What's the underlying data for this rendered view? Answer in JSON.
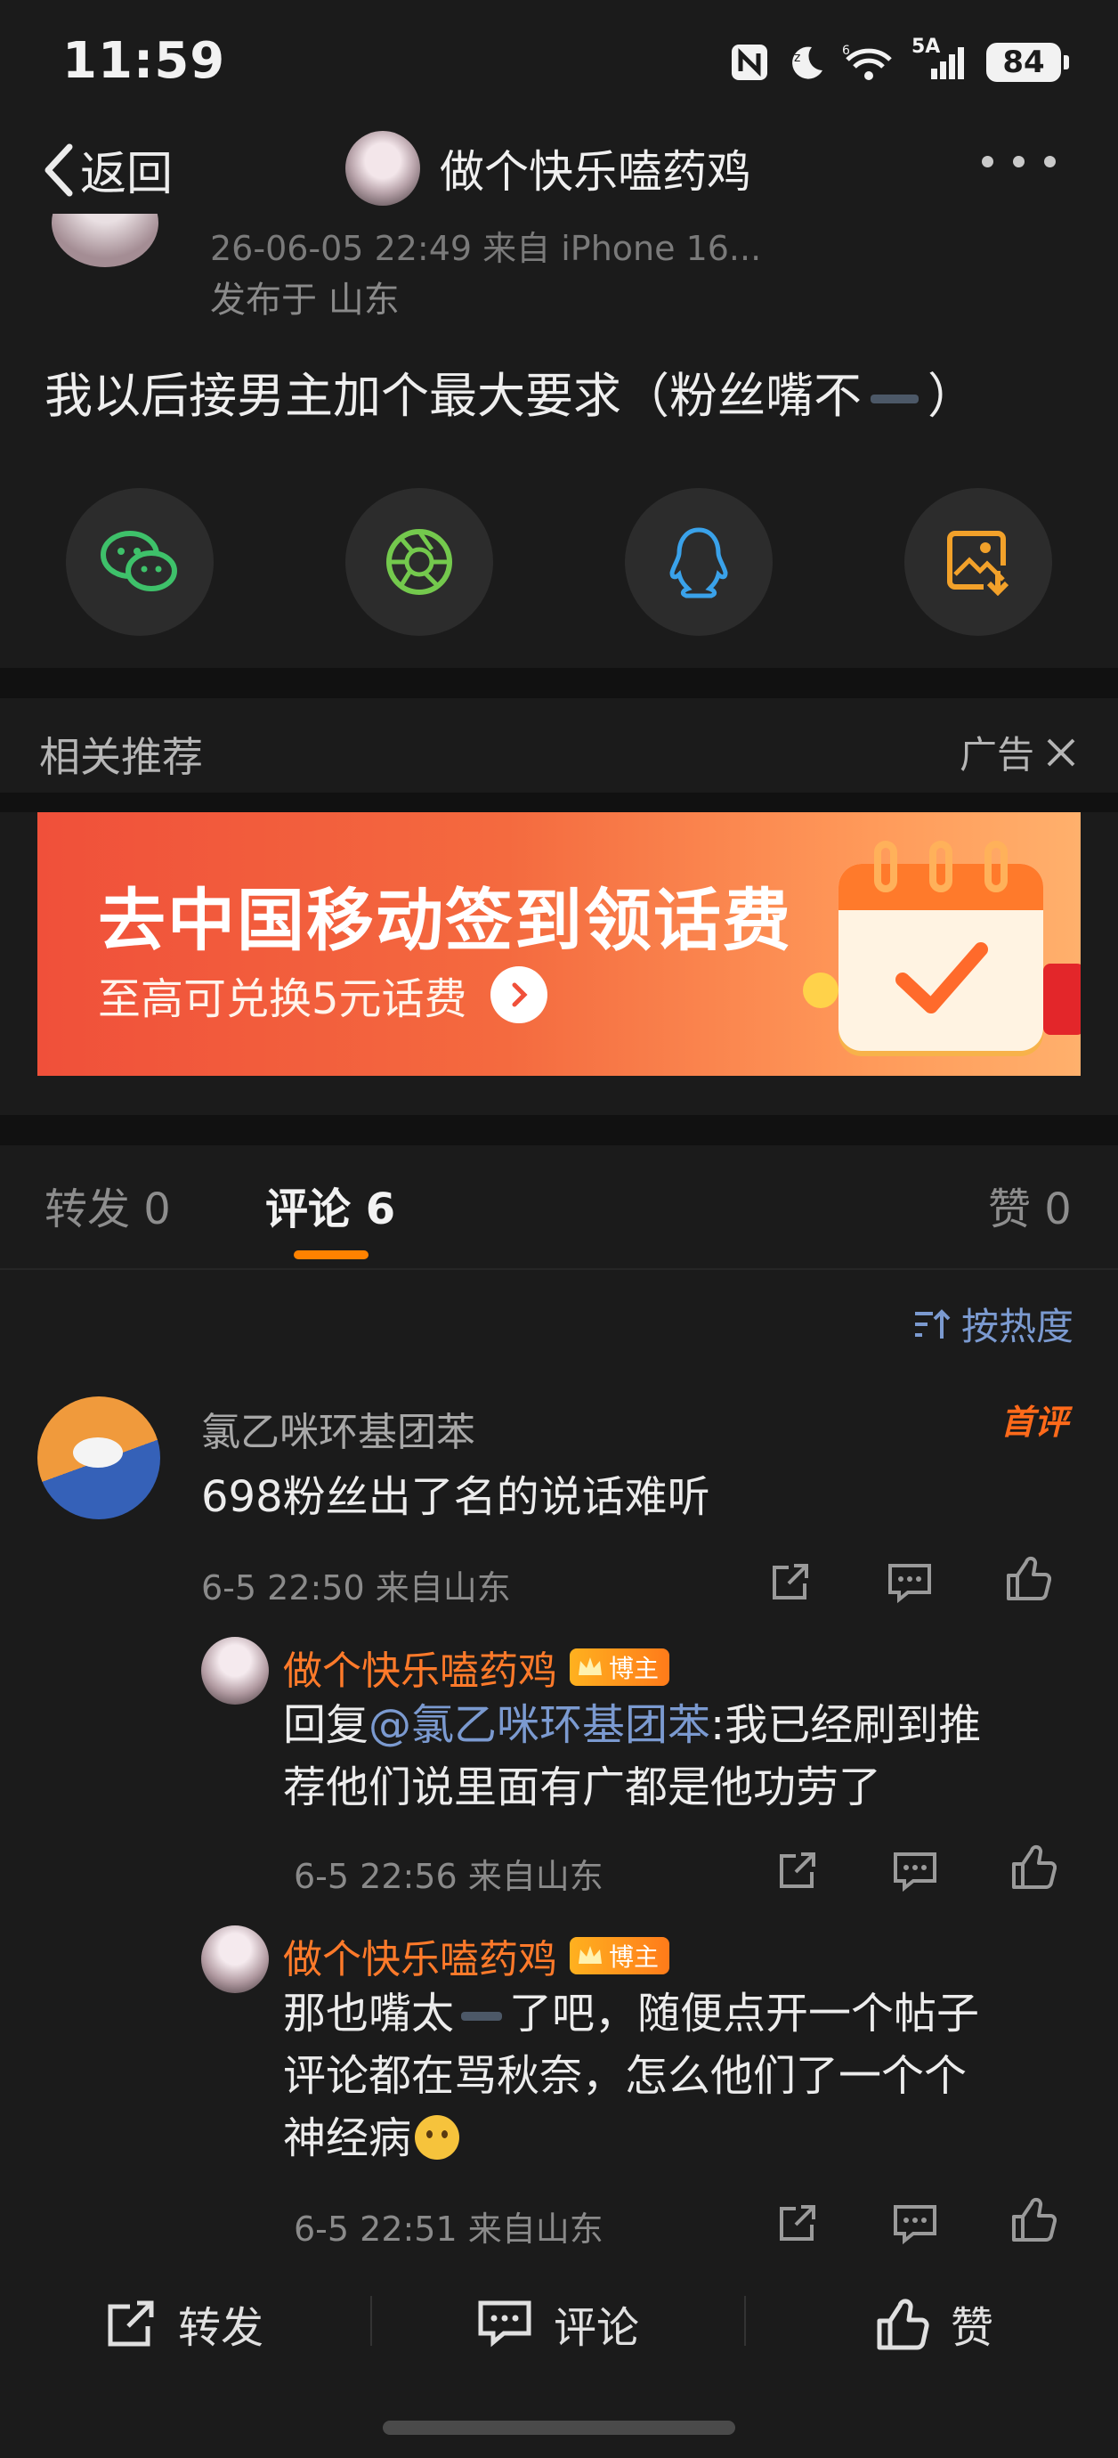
{
  "status_bar": {
    "time": "11:59",
    "network": "5A",
    "signal_gen": "6",
    "battery": "84"
  },
  "nav": {
    "back_label": "返回",
    "title": "做个快乐嗑药鸡"
  },
  "post": {
    "meta_time": "26-06-05 22:49  来自 iPhone 16...",
    "location": "发布于 山东",
    "text_before": "我以后接男主加个最大要求（粉丝嘴不",
    "text_after": "）"
  },
  "share": [
    "wechat-icon",
    "moments-icon",
    "qq-icon",
    "save-image-icon"
  ],
  "recommend": {
    "label": "相关推荐",
    "ad_label": "广告",
    "banner_title": "去中国移动签到领话费",
    "banner_sub": "至高可兑换5元话费"
  },
  "tabs": {
    "repost": "转发",
    "repost_count": "0",
    "comment": "评论",
    "comment_count": "6",
    "like": "赞",
    "like_count": "0"
  },
  "sort_label": "按热度",
  "comments": {
    "main": {
      "name": "氯乙咪环基团苯",
      "badge": "首评",
      "text": "698粉丝出了名的说话难听",
      "meta": "6-5 22:50 来自山东"
    },
    "reply1": {
      "name": "做个快乐嗑药鸡",
      "badge": "博主",
      "prefix": "回复",
      "mention": "@氯乙咪环基团苯",
      "text_line1_rest": ":我已经刷到推",
      "text_line2": "荐他们说里面有广都是他功劳了",
      "meta": "6-5 22:56 来自山东"
    },
    "reply2": {
      "name": "做个快乐嗑药鸡",
      "badge": "博主",
      "line1_a": "那也嘴太",
      "line1_b": "了吧，随便点开一个帖子",
      "line2": "评论都在骂秋奈，怎么他们了一个个",
      "line3": "神经病",
      "meta": "6-5 22:51 来自山东"
    }
  },
  "bottom_bar": {
    "repost": "转发",
    "comment": "评论",
    "like": "赞"
  },
  "colors": {
    "background": "#1b1b1b",
    "accent_orange": "#ff8200",
    "link_blue": "#7b9ad0",
    "host_name": "#ff7a2a"
  }
}
